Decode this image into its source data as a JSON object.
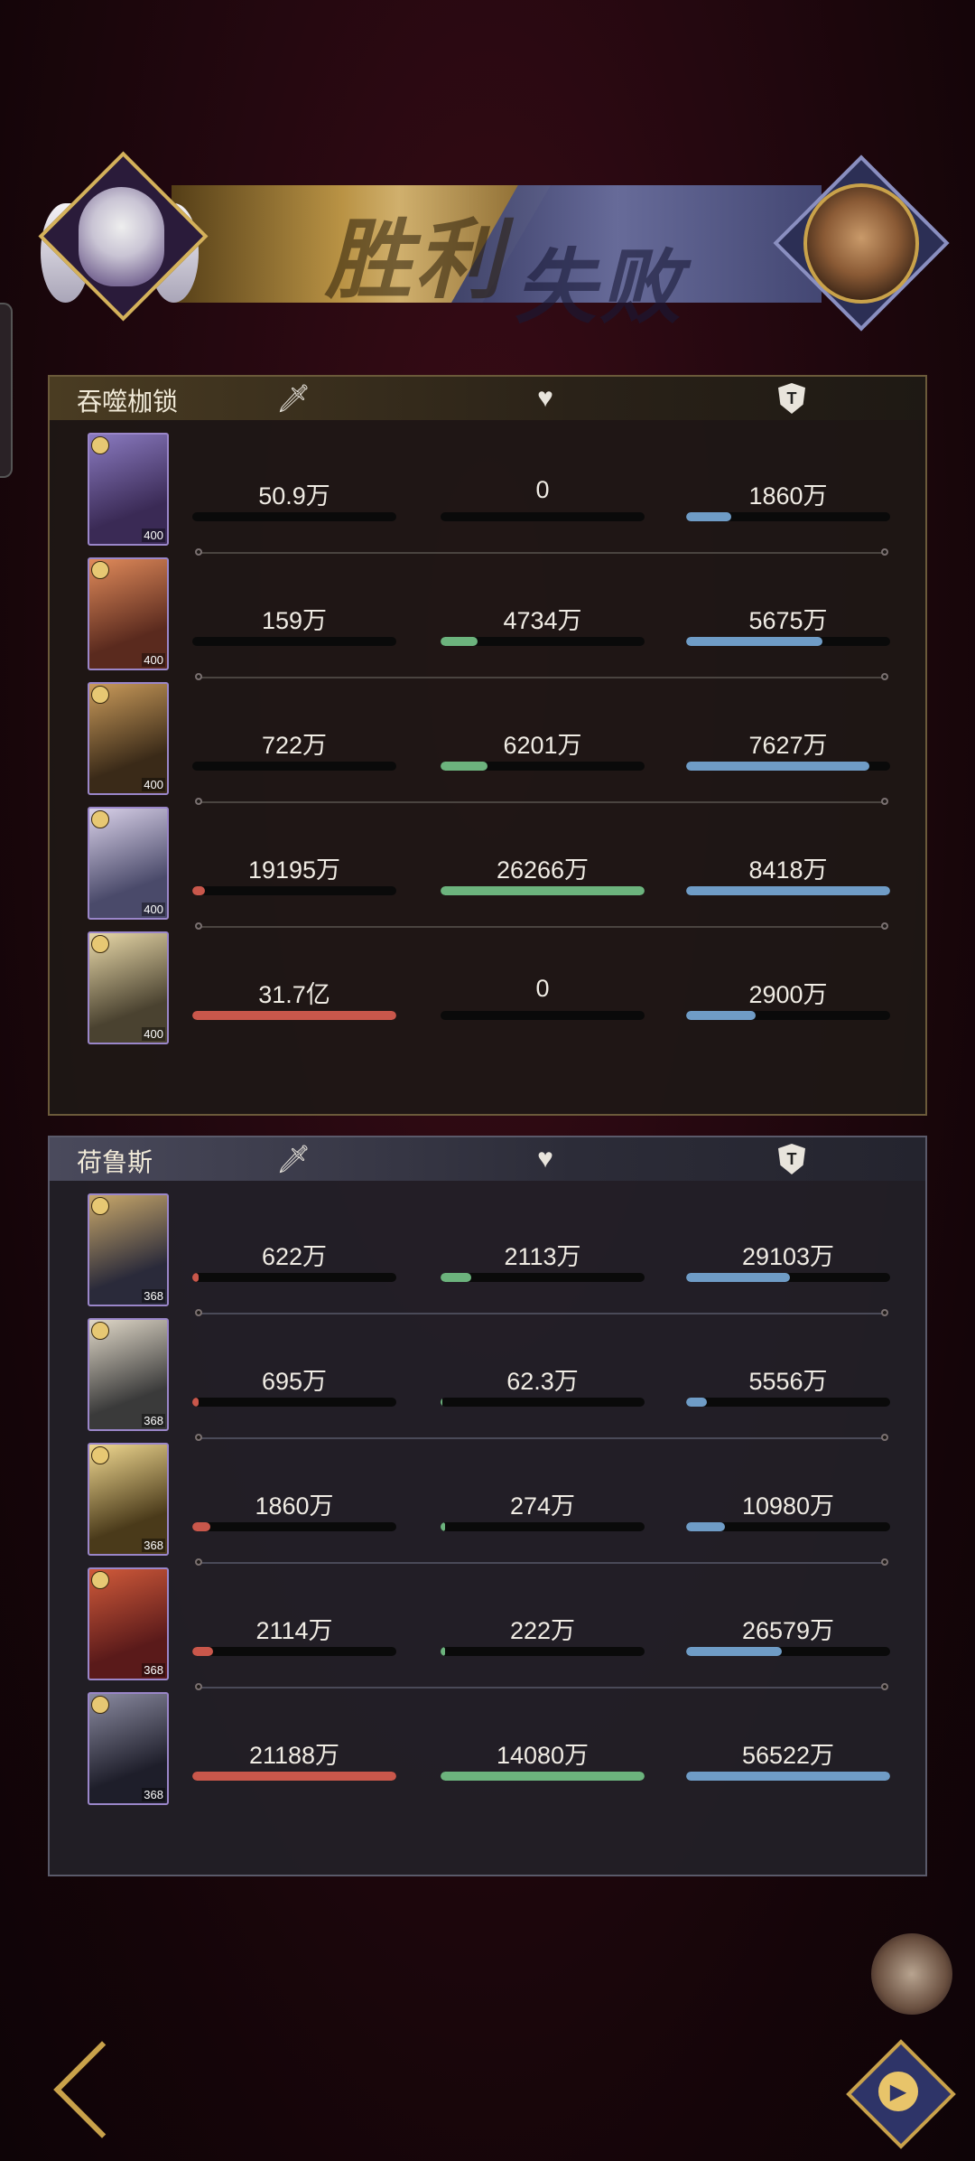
{
  "banner": {
    "victory_label": "胜利",
    "defeat_label": "失败"
  },
  "columns": [
    "damage",
    "healing",
    "damage_taken"
  ],
  "icons": {
    "damage": "sword-icon",
    "healing": "heart-icon",
    "damage_taken": "shield-icon"
  },
  "teams": [
    {
      "name": "吞噬枷锁",
      "heroes": [
        {
          "level": "400",
          "damage": "50.9万",
          "healing": "0",
          "taken": "1860万",
          "damage_ratio": 0.0,
          "healing_ratio": 0.0,
          "taken_ratio": 0.22
        },
        {
          "level": "400",
          "damage": "159万",
          "healing": "4734万",
          "taken": "5675万",
          "damage_ratio": 0.0,
          "healing_ratio": 0.18,
          "taken_ratio": 0.67
        },
        {
          "level": "400",
          "damage": "722万",
          "healing": "6201万",
          "taken": "7627万",
          "damage_ratio": 0.0,
          "healing_ratio": 0.23,
          "taken_ratio": 0.9
        },
        {
          "level": "400",
          "damage": "19195万",
          "healing": "26266万",
          "taken": "8418万",
          "damage_ratio": 0.06,
          "healing_ratio": 1.0,
          "taken_ratio": 1.0
        },
        {
          "level": "400",
          "damage": "31.7亿",
          "healing": "0",
          "taken": "2900万",
          "damage_ratio": 1.0,
          "healing_ratio": 0.0,
          "taken_ratio": 0.34
        }
      ]
    },
    {
      "name": "荷鲁斯",
      "heroes": [
        {
          "level": "368",
          "damage": "622万",
          "healing": "2113万",
          "taken": "29103万",
          "damage_ratio": 0.03,
          "healing_ratio": 0.15,
          "taken_ratio": 0.51
        },
        {
          "level": "368",
          "damage": "695万",
          "healing": "62.3万",
          "taken": "5556万",
          "damage_ratio": 0.03,
          "healing_ratio": 0.01,
          "taken_ratio": 0.1
        },
        {
          "level": "368",
          "damage": "1860万",
          "healing": "274万",
          "taken": "10980万",
          "damage_ratio": 0.09,
          "healing_ratio": 0.02,
          "taken_ratio": 0.19
        },
        {
          "level": "368",
          "damage": "2114万",
          "healing": "222万",
          "taken": "26579万",
          "damage_ratio": 0.1,
          "healing_ratio": 0.02,
          "taken_ratio": 0.47
        },
        {
          "level": "368",
          "damage": "21188万",
          "healing": "14080万",
          "taken": "56522万",
          "damage_ratio": 1.0,
          "healing_ratio": 1.0,
          "taken_ratio": 1.0
        }
      ]
    }
  ],
  "colors": {
    "damage_bar": "#c9574b",
    "healing_bar": "#6cb37d",
    "taken_bar": "#6f9cc6",
    "gold_accent": "#c9a24a"
  }
}
